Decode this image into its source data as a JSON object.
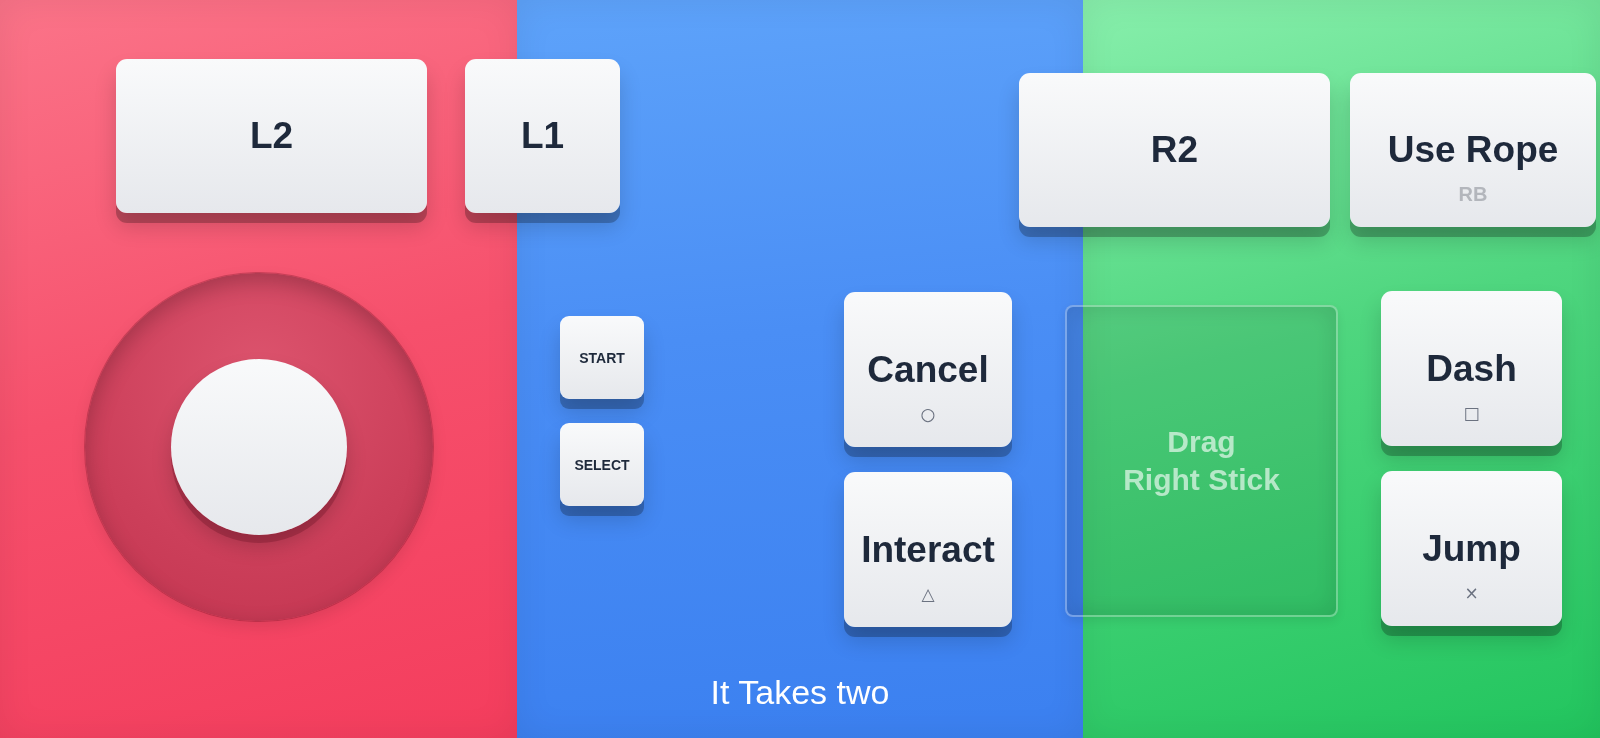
{
  "left_shoulder": [
    {
      "label": "L2"
    },
    {
      "label": "L1"
    }
  ],
  "right_shoulder": [
    {
      "label": "R2"
    },
    {
      "label": "Use Rope",
      "hint": "RB"
    }
  ],
  "menu_buttons": [
    {
      "label": "START"
    },
    {
      "label": "SELECT"
    }
  ],
  "action_buttons_left": [
    {
      "label": "Cancel",
      "symbol": "○"
    },
    {
      "label": "Interact",
      "symbol": "△"
    }
  ],
  "drag_area": {
    "label": "Drag\nRight Stick"
  },
  "action_buttons_right": [
    {
      "label": "Dash",
      "symbol": "□"
    },
    {
      "label": "Jump",
      "symbol": "×"
    }
  ],
  "title": "It Takes two"
}
